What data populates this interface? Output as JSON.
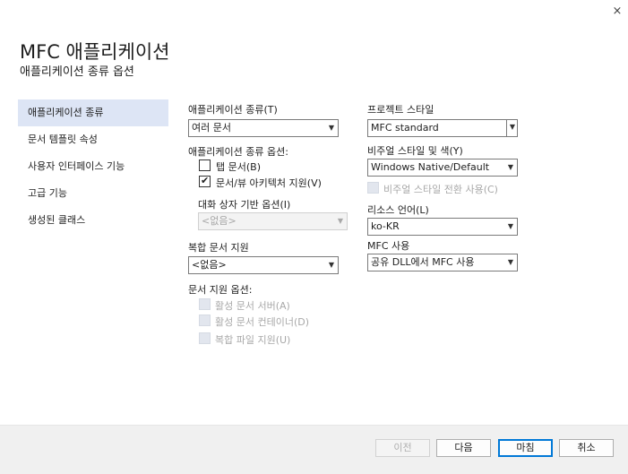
{
  "dialog": {
    "title": "MFC 애플리케이션",
    "subtitle": "애플리케이션 종류 옵션",
    "close_glyph": "×"
  },
  "sidebar": {
    "items": [
      {
        "label": "애플리케이션 종류",
        "selected": true
      },
      {
        "label": "문서 템플릿 속성",
        "selected": false
      },
      {
        "label": "사용자 인터페이스 기능",
        "selected": false
      },
      {
        "label": "고급 기능",
        "selected": false
      },
      {
        "label": "생성된 클래스",
        "selected": false
      }
    ]
  },
  "left": {
    "app_type": {
      "label": "애플리케이션 종류(T)",
      "value": "여러 문서"
    },
    "app_type_options": {
      "label": "애플리케이션 종류 옵션:",
      "tabbed": {
        "label": "탭 문서(B)",
        "checked": false
      },
      "docview": {
        "label": "문서/뷰 아키텍처 지원(V)",
        "checked": true
      }
    },
    "dialog_options": {
      "label": "대화 상자 기반 옵션(I)",
      "value": "<없음>"
    },
    "compound": {
      "label": "복합 문서 지원",
      "value": "<없음>"
    },
    "doc_support": {
      "label": "문서 지원 옵션:",
      "items": [
        {
          "label": "활성 문서 서버(A)"
        },
        {
          "label": "활성 문서 컨테이너(D)"
        },
        {
          "label": "복합 파일 지원(U)"
        }
      ]
    }
  },
  "right": {
    "project_style": {
      "label": "프로젝트 스타일",
      "value": "MFC standard"
    },
    "visual_style": {
      "label": "비주얼 스타일 및 색(Y)",
      "value": "Windows Native/Default"
    },
    "visual_switch": {
      "label": "비주얼 스타일 전환 사용(C)"
    },
    "resource_lang": {
      "label": "리소스 언어(L)",
      "value": "ko-KR"
    },
    "mfc_use": {
      "label": "MFC 사용",
      "value": "공유 DLL에서 MFC 사용"
    }
  },
  "footer": {
    "prev": "이전",
    "next": "다음",
    "finish": "마침",
    "cancel": "취소"
  },
  "icons": {
    "dropdown": "▼",
    "check": "✔"
  }
}
